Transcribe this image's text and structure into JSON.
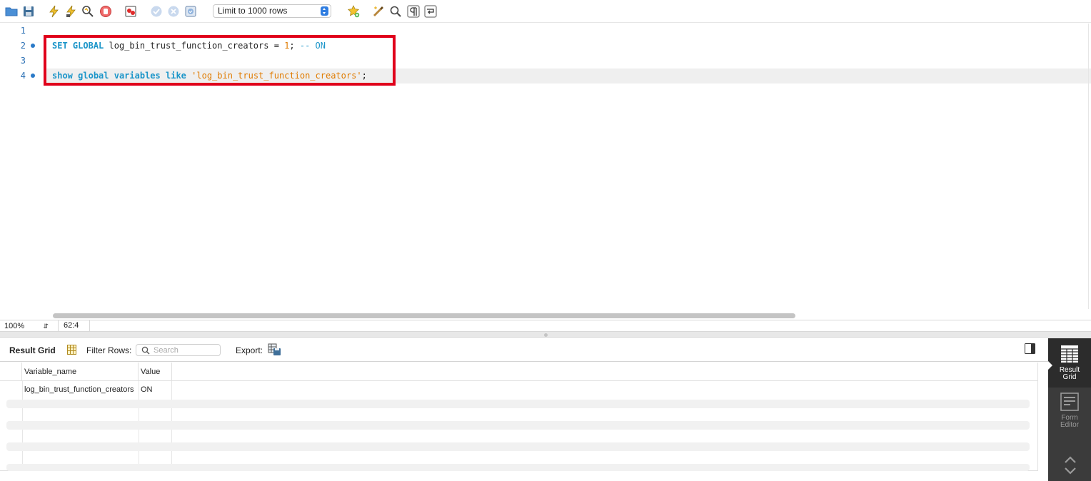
{
  "toolbar": {
    "icons": [
      "open-folder-icon",
      "save-icon",
      "execute-icon",
      "execute-current-icon",
      "explain-icon",
      "stop-icon",
      "toggle-error-icon",
      "commit-icon",
      "rollback-icon",
      "autocommit-icon",
      "snippet-icon",
      "beautify-icon",
      "find-icon",
      "invisible-chars-icon",
      "wrap-icon"
    ],
    "limit_select": "Limit to 1000 rows"
  },
  "editor": {
    "line_numbers": [
      "1",
      "2",
      "3",
      "4"
    ],
    "lines": [
      {
        "tokens": []
      },
      {
        "tokens": [
          {
            "t": "SET",
            "c": "kw"
          },
          {
            "t": " ",
            "c": "plain"
          },
          {
            "t": "GLOBAL",
            "c": "kw"
          },
          {
            "t": " log_bin_trust_function_creators = ",
            "c": "plain"
          },
          {
            "t": "1",
            "c": "num"
          },
          {
            "t": "; ",
            "c": "plain"
          },
          {
            "t": "-- ON",
            "c": "cmt"
          }
        ]
      },
      {
        "tokens": []
      },
      {
        "tokens": [
          {
            "t": "show",
            "c": "kw"
          },
          {
            "t": " ",
            "c": "plain"
          },
          {
            "t": "global",
            "c": "kw"
          },
          {
            "t": " ",
            "c": "plain"
          },
          {
            "t": "variables",
            "c": "kw"
          },
          {
            "t": " ",
            "c": "plain"
          },
          {
            "t": "like",
            "c": "kw"
          },
          {
            "t": " ",
            "c": "plain"
          },
          {
            "t": "'log_bin_trust_function_creators'",
            "c": "str"
          },
          {
            "t": ";",
            "c": "plain"
          }
        ]
      }
    ],
    "statement_markers": [
      "2",
      "4"
    ],
    "highlight_color": "#e0001b"
  },
  "status": {
    "zoom": "100%",
    "cursor": "62:4"
  },
  "result": {
    "title": "Result Grid",
    "filter_label": "Filter Rows:",
    "search_placeholder": "Search",
    "export_label": "Export:",
    "columns": [
      "Variable_name",
      "Value"
    ],
    "rows": [
      [
        "log_bin_trust_function_creators",
        "ON"
      ]
    ]
  },
  "side_panel": {
    "result_grid_label_1": "Result",
    "result_grid_label_2": "Grid",
    "form_editor_label_1": "Form",
    "form_editor_label_2": "Editor"
  }
}
